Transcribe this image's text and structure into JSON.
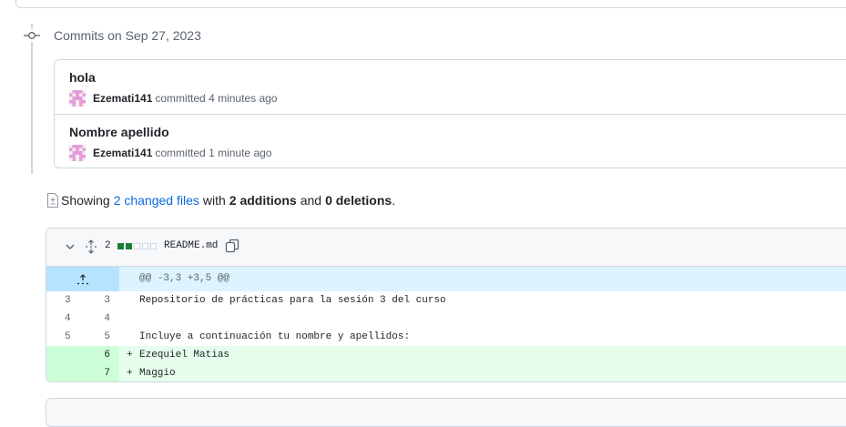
{
  "commits": {
    "heading": "Commits on Sep 27, 2023",
    "items": [
      {
        "title": "hola",
        "author": "Ezemati141",
        "action": "committed",
        "time": "4 minutes ago"
      },
      {
        "title": "Nombre apellido",
        "author": "Ezemati141",
        "action": "committed",
        "time": "1 minute ago"
      }
    ]
  },
  "summary": {
    "showing": "Showing",
    "changed_files": "2 changed files",
    "with": "with",
    "additions": "2 additions",
    "and": "and",
    "deletions": "0 deletions",
    "period": "."
  },
  "diff": {
    "change_count": "2",
    "diffstat": {
      "added_blocks": 2,
      "neutral_blocks": 3
    },
    "filename": "README.md",
    "hunk_header": "@@ -3,3 +3,5 @@",
    "lines": [
      {
        "old": "3",
        "new": "3",
        "type": "context",
        "marker": "",
        "text": "Repositorio de prácticas para la sesión 3 del curso"
      },
      {
        "old": "4",
        "new": "4",
        "type": "context",
        "marker": "",
        "text": ""
      },
      {
        "old": "5",
        "new": "5",
        "type": "context",
        "marker": "",
        "text": "Incluye a continuación tu nombre y apellidos:"
      },
      {
        "old": "",
        "new": "6",
        "type": "add",
        "marker": "+",
        "text": "Ezequiel Matias"
      },
      {
        "old": "",
        "new": "7",
        "type": "add",
        "marker": "+",
        "text": "Maggio"
      }
    ]
  },
  "colors": {
    "accent_link": "#0969da",
    "added_line_bg": "#e6ffec",
    "added_gutter_bg": "#ccffd8",
    "hunk_bg": "#ddf4ff",
    "diffstat_green": "#1a7f37"
  },
  "icons": [
    "commit-node-icon",
    "avatar",
    "file-diff-icon",
    "chevron-down-icon",
    "unfold-icon",
    "copy-icon",
    "expand-up-icon"
  ]
}
